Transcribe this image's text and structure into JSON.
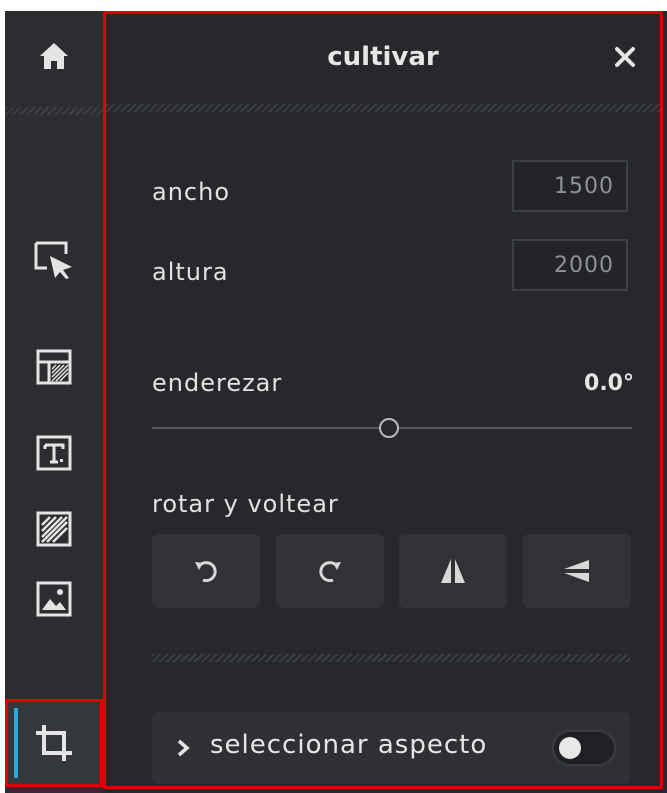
{
  "sidebar": {
    "items": [
      {
        "icon": "home-icon"
      },
      {
        "icon": "select-pointer-icon"
      },
      {
        "icon": "layout-icon"
      },
      {
        "icon": "text-icon"
      },
      {
        "icon": "pattern-icon"
      },
      {
        "icon": "image-icon"
      },
      {
        "icon": "crop-icon",
        "active": true
      }
    ],
    "accent_color": "#2aa8d8"
  },
  "panel": {
    "title": "cultivar",
    "close_icon": "close-icon",
    "width_label": "ancho",
    "width_value": "1500",
    "height_label": "altura",
    "height_value": "2000",
    "straighten_label": "enderezar",
    "straighten_value": "0.0°",
    "straighten_level": 0.5,
    "rotate_flip_label": "rotar y voltear",
    "rotate_buttons": [
      {
        "icon": "rotate-left-icon"
      },
      {
        "icon": "rotate-right-icon"
      },
      {
        "icon": "flip-horizontal-icon"
      },
      {
        "icon": "flip-vertical-icon"
      }
    ],
    "aspect_label": "seleccionar aspecto",
    "aspect_enabled": false
  },
  "colors": {
    "highlight": "#e00000",
    "background": "#26282b"
  }
}
